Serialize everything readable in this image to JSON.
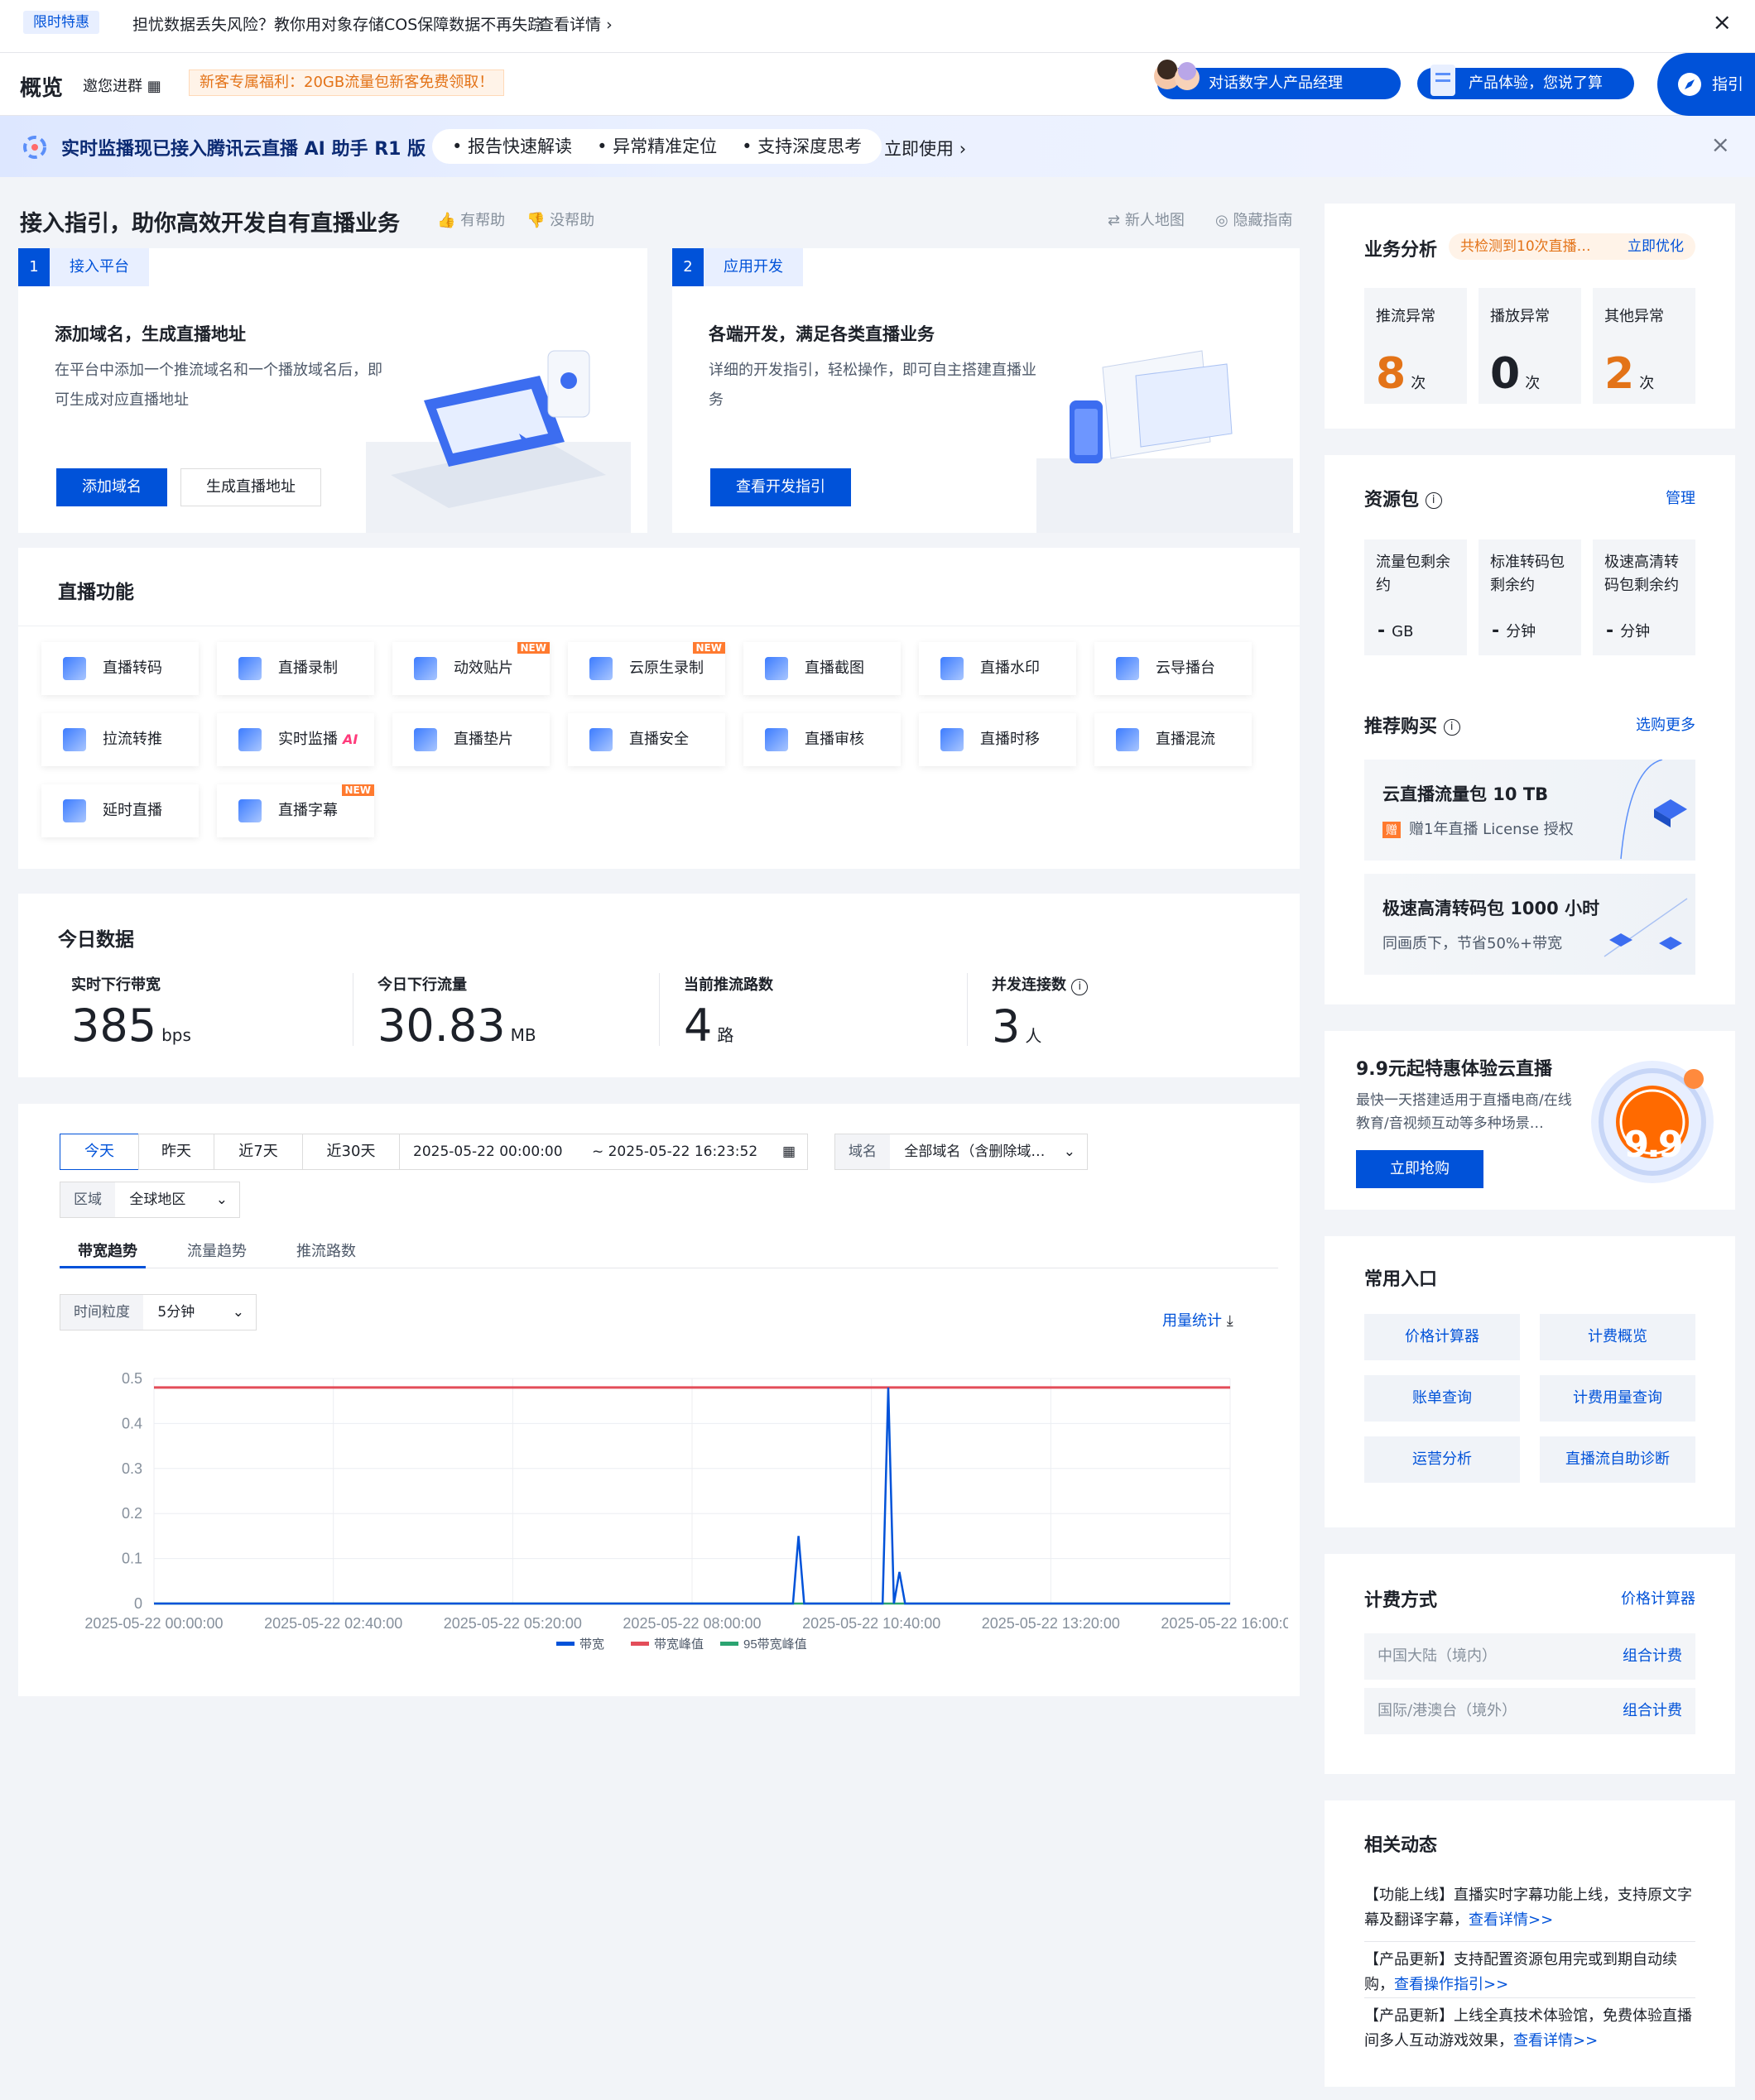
{
  "promo": {
    "tag": "限时特惠",
    "text": "担忧数据丢失风险？教你用对象存储COS保障数据不再失踪",
    "link": "查看详情"
  },
  "header": {
    "title": "概览",
    "invite": "邀您进群",
    "gift": "新客专属福利：20GB流量包新客免费领取！",
    "digital_manager": "对话数字人产品经理",
    "feedback": "产品体验，您说了算",
    "guide": "指引"
  },
  "aibar": {
    "title": "实时监播现已接入腾讯云直播 AI 助手 R1 版",
    "chips": [
      "• 报告快速解读",
      "• 异常精准定位",
      "• 支持深度思考"
    ],
    "use": "立即使用"
  },
  "guide": {
    "title": "接入指引，助你高效开发自有直播业务",
    "helpful": "有帮助",
    "unhelpful": "没帮助",
    "map": "新人地图",
    "hide": "隐藏指南",
    "steps": [
      {
        "num": "1",
        "label": "接入平台",
        "heading": "添加域名，生成直播地址",
        "desc": "在平台中添加一个推流域名和一个播放域名后，即可生成对应直播地址",
        "btn1": "添加域名",
        "btn2": "生成直播地址"
      },
      {
        "num": "2",
        "label": "应用开发",
        "heading": "各端开发，满足各类直播业务",
        "desc": "详细的开发指引，轻松操作，即可自主搭建直播业务",
        "btn1": "查看开发指引"
      }
    ]
  },
  "features": {
    "title": "直播功能",
    "new_badge": "NEW",
    "items": [
      {
        "label": "直播转码",
        "badge": ""
      },
      {
        "label": "直播录制",
        "badge": ""
      },
      {
        "label": "动效贴片",
        "badge": "NEW"
      },
      {
        "label": "云原生录制",
        "badge": "NEW"
      },
      {
        "label": "直播截图",
        "badge": ""
      },
      {
        "label": "直播水印",
        "badge": ""
      },
      {
        "label": "云导播台",
        "badge": ""
      },
      {
        "label": "拉流转推",
        "badge": ""
      },
      {
        "label": "实时监播",
        "badge": "AI"
      },
      {
        "label": "直播垫片",
        "badge": ""
      },
      {
        "label": "直播安全",
        "badge": ""
      },
      {
        "label": "直播审核",
        "badge": ""
      },
      {
        "label": "直播时移",
        "badge": ""
      },
      {
        "label": "直播混流",
        "badge": ""
      },
      {
        "label": "延时直播",
        "badge": ""
      },
      {
        "label": "直播字幕",
        "badge": "NEW"
      }
    ]
  },
  "today": {
    "title": "今日数据",
    "stats": [
      {
        "label": "实时下行带宽",
        "value": "385",
        "unit": "bps"
      },
      {
        "label": "今日下行流量",
        "value": "30.83",
        "unit": "MB"
      },
      {
        "label": "当前推流路数",
        "value": "4",
        "unit": "路"
      },
      {
        "label": "并发连接数",
        "value": "3",
        "unit": "人"
      }
    ]
  },
  "filters": {
    "ranges": [
      "今天",
      "昨天",
      "近7天",
      "近30天"
    ],
    "start": "2025-05-22 00:00:00",
    "end": "~ 2025-05-22 16:23:52",
    "domain_label": "域名",
    "domain_value": "全部域名（含删除域…",
    "region_label": "区域",
    "region_value": "全球地区",
    "tabs": [
      "带宽趋势",
      "流量趋势",
      "推流路数"
    ],
    "granularity_label": "时间粒度",
    "granularity_value": "5分钟",
    "usage": "用量统计"
  },
  "chart_data": {
    "type": "line",
    "x_ticks": [
      "2025-05-22 00:00:00",
      "2025-05-22 02:40:00",
      "2025-05-22 05:20:00",
      "2025-05-22 08:00:00",
      "2025-05-22 10:40:00",
      "2025-05-22 13:20:00",
      "2025-05-22 16:00:00"
    ],
    "ylim": [
      0,
      0.5
    ],
    "y_ticks": [
      "0",
      "0.1",
      "0.2",
      "0.3",
      "0.4",
      "0.5"
    ],
    "x_minutes_range": [
      0,
      960
    ],
    "series": [
      {
        "name": "带宽",
        "color": "#0052d9",
        "points": [
          [
            0,
            0
          ],
          [
            570,
            0
          ],
          [
            575,
            0.15
          ],
          [
            580,
            0
          ],
          [
            650,
            0
          ],
          [
            655,
            0.48
          ],
          [
            660,
            0
          ],
          [
            665,
            0.07
          ],
          [
            670,
            0
          ],
          [
            960,
            0
          ]
        ]
      },
      {
        "name": "带宽峰值",
        "color": "#e34d59",
        "points": [
          [
            0,
            0.48
          ],
          [
            960,
            0.48
          ]
        ]
      },
      {
        "name": "95带宽峰值",
        "color": "#2ba471",
        "points": [
          [
            0,
            0
          ],
          [
            960,
            0
          ]
        ]
      }
    ],
    "legend": "bottom"
  },
  "analysis": {
    "title": "业务分析",
    "badge": "共检测到10次直播…",
    "optimize": "立即优化",
    "items": [
      {
        "label": "推流异常",
        "value": "8",
        "unit": "次",
        "color": "#e37318"
      },
      {
        "label": "播放异常",
        "value": "0",
        "unit": "次",
        "color": "#1d2129"
      },
      {
        "label": "其他异常",
        "value": "2",
        "unit": "次",
        "color": "#e37318"
      }
    ]
  },
  "resources": {
    "title": "资源包",
    "manage": "管理",
    "items": [
      {
        "label": "流量包剩余约",
        "value": "-",
        "unit": "GB"
      },
      {
        "label": "标准转码包剩余约",
        "value": "-",
        "unit": "分钟"
      },
      {
        "label": "极速高清转码包剩余约",
        "value": "-",
        "unit": "分钟"
      }
    ]
  },
  "recommend": {
    "title": "推荐购买",
    "more": "选购更多",
    "items": [
      {
        "title": "云直播流量包 10 TB",
        "gift_tag": "赠",
        "sub": "赠1年直播 License 授权"
      },
      {
        "title": "极速高清转码包 1000 小时",
        "sub": "同画质下，节省50%+带宽"
      }
    ]
  },
  "trial": {
    "title": "9.9元起特惠体验云直播",
    "desc": "最快一天搭建适用于直播电商/在线教育/音视频互动等多种场景…",
    "btn": "立即抢购",
    "price": "9.9"
  },
  "quick": {
    "title": "常用入口",
    "items": [
      "价格计算器",
      "计费概览",
      "账单查询",
      "计费用量查询",
      "运营分析",
      "直播流自助诊断"
    ]
  },
  "billing": {
    "title": "计费方式",
    "calc": "价格计算器",
    "rows": [
      {
        "label": "中国大陆（境内）",
        "action": "组合计费"
      },
      {
        "label": "国际/港澳台（境外）",
        "action": "组合计费"
      }
    ]
  },
  "news": {
    "title": "相关动态",
    "items": [
      {
        "text": "【功能上线】直播实时字幕功能上线，支持原文字幕及翻译字幕，",
        "link": "查看详情>>"
      },
      {
        "text": "【产品更新】支持配置资源包用完或到期自动续购，",
        "link": "查看操作指引>>"
      },
      {
        "text": "【产品更新】上线全真技术体验馆，免费体验直播间多人互动游戏效果，",
        "link": "查看详情>>"
      }
    ]
  }
}
